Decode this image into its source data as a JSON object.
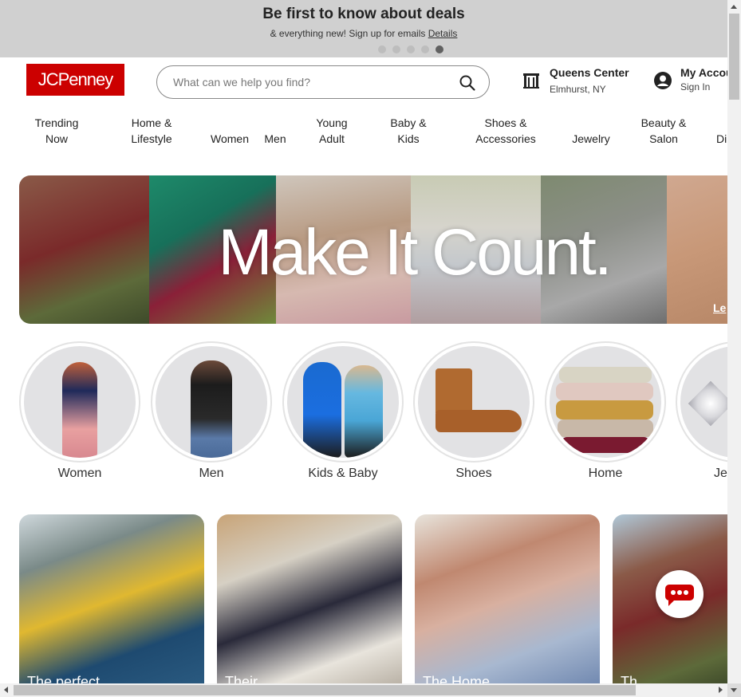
{
  "promo": {
    "title": "Be first to know about deals",
    "subtitle": "& everything new! Sign up for emails",
    "details_link": "Details",
    "slide_count": 5,
    "active_slide": 5
  },
  "header": {
    "logo": "JCPenney",
    "search_placeholder": "What can we help you find?",
    "store_name": "Queens Center",
    "store_location": "Elmhurst, NY",
    "account_title": "My Account",
    "account_sub": "Sign In"
  },
  "nav": {
    "items": [
      {
        "line1": "Trending",
        "line2": "Now"
      },
      {
        "line1": "Home &",
        "line2": "Lifestyle"
      },
      {
        "line1": "Women",
        "line2": ""
      },
      {
        "line1": "Men",
        "line2": ""
      },
      {
        "line1": "Young",
        "line2": "Adult"
      },
      {
        "line1": "Baby &",
        "line2": "Kids"
      },
      {
        "line1": "Shoes &",
        "line2": "Accessories"
      },
      {
        "line1": "Jewelry",
        "line2": ""
      },
      {
        "line1": "Beauty &",
        "line2": "Salon"
      },
      {
        "line1": "Di",
        "line2": ""
      }
    ]
  },
  "hero": {
    "headline": "Make It Count.",
    "link": "Le"
  },
  "categories": [
    {
      "label": "Women"
    },
    {
      "label": "Men"
    },
    {
      "label": "Kids & Baby"
    },
    {
      "label": "Shoes"
    },
    {
      "label": "Home"
    },
    {
      "label": "Jev"
    }
  ],
  "cards": [
    {
      "caption": "The perfect"
    },
    {
      "caption": "Their"
    },
    {
      "caption": "The Home"
    },
    {
      "caption": "Th"
    }
  ],
  "colors": {
    "brand_red": "#cc0000",
    "promo_bg": "#d0d0d0"
  },
  "icons": {
    "search": "search-icon",
    "store": "store-icon",
    "account": "account-icon",
    "chat": "chat-icon"
  }
}
